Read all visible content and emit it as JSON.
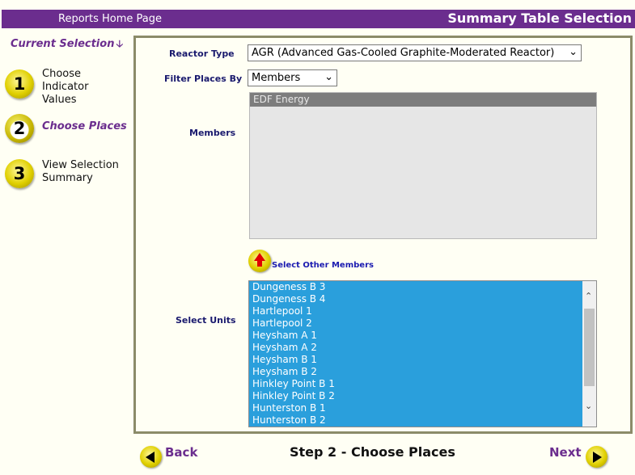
{
  "header": {
    "home_link": "Reports Home Page",
    "title": "Summary Table Selection"
  },
  "sidebar": {
    "current_selection": "Current Selection",
    "steps": [
      {
        "num": "1",
        "label": "Choose Indicator Values",
        "active": false
      },
      {
        "num": "2",
        "label": "Choose Places",
        "active": true
      },
      {
        "num": "3",
        "label": "View Selection Summary",
        "active": false
      }
    ]
  },
  "form": {
    "reactor_type_label": "Reactor Type",
    "reactor_type_value": "AGR (Advanced Gas-Cooled Graphite-Moderated Reactor)",
    "filter_label": "Filter Places By",
    "filter_value": "Members",
    "members_label": "Members",
    "members": [
      "EDF Energy"
    ],
    "select_other_members": "Select Other Members",
    "units_label": "Select Units",
    "units": [
      "Dungeness B 3",
      "Dungeness B 4",
      "Hartlepool 1",
      "Hartlepool 2",
      "Heysham A 1",
      "Heysham A 2",
      "Heysham B 1",
      "Heysham B 2",
      "Hinkley Point B 1",
      "Hinkley Point B 2",
      "Hunterston B 1",
      "Hunterston B 2"
    ]
  },
  "footer": {
    "back": "Back",
    "step_title": "Step 2 - Choose Places",
    "next": "Next"
  },
  "colors": {
    "brand": "#6b2d8e",
    "selection": "#2a9fdc",
    "button": "#e0d000"
  }
}
